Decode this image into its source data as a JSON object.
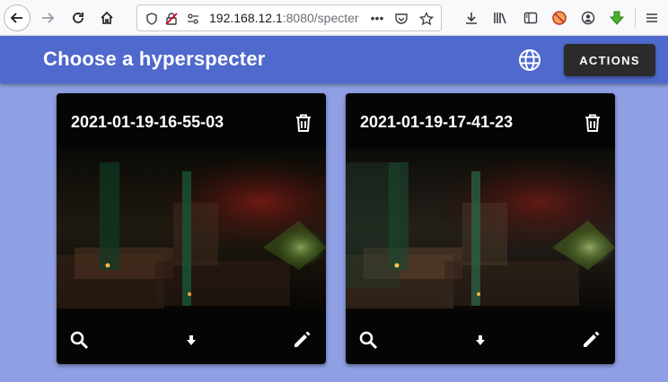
{
  "browser": {
    "url_host": "192.168.12.1",
    "url_rest": ":8080/specter",
    "url_dots": "•••"
  },
  "app": {
    "title": "Choose a hyperspecter",
    "actions_label": "ACTIONS"
  },
  "cards": [
    {
      "title": "2021-01-19-16-55-03"
    },
    {
      "title": "2021-01-19-17-41-23"
    }
  ],
  "colors": {
    "toolbar": "#4f69cc",
    "background": "#8f9fe3",
    "card": "#050505",
    "actions_button": "#2b2b2b"
  },
  "icons": {
    "card_actions": [
      "search-icon",
      "download-icon",
      "edit-icon"
    ],
    "card_header": "trash-icon",
    "toolbar": "globe-icon"
  }
}
